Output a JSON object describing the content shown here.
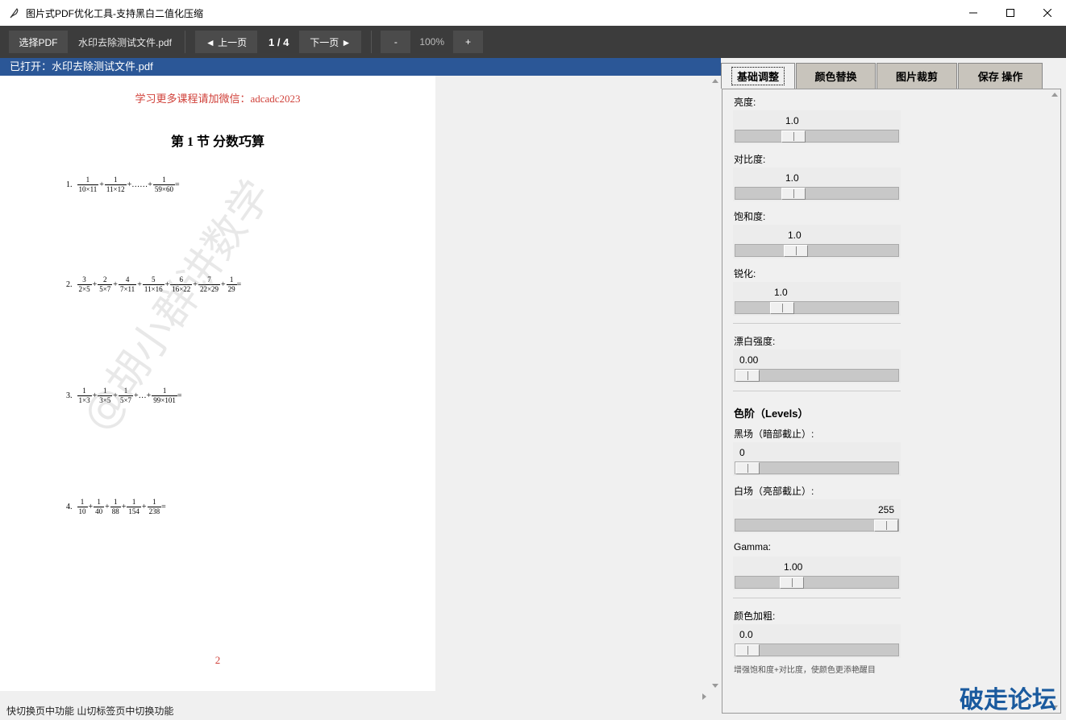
{
  "window": {
    "title": "图片式PDF优化工具-支持黑白二值化压缩",
    "icon": "feather-icon"
  },
  "toolbar": {
    "select_pdf": "选择PDF",
    "filename": "水印去除测试文件.pdf",
    "prev": "◄ 上一页",
    "page_indicator": "1 / 4",
    "next": "下一页 ►",
    "zoom_out": "-",
    "zoom": "100%",
    "zoom_in": "+"
  },
  "viewer": {
    "opened": "已打开：水印去除测试文件.pdf",
    "status": "快切换页中功能 山切标签页中切换功能"
  },
  "pdf": {
    "header": "学习更多课程请加微信：adcadc2023",
    "heading": "第 1 节  分数巧算",
    "watermark": "@胡小群讲数学",
    "page_number": "2",
    "problems": [
      {
        "num": "1.",
        "fracs": [
          [
            "1",
            "10×11"
          ],
          [
            "1",
            "11×12"
          ],
          [
            "1",
            "59×60"
          ]
        ],
        "ellipsis": "+……+",
        "end": "="
      },
      {
        "num": "2.",
        "fracs": [
          [
            "3",
            "2×5"
          ],
          [
            "2",
            "5×7"
          ],
          [
            "4",
            "7×11"
          ],
          [
            "5",
            "11×16"
          ],
          [
            "6",
            "16×22"
          ],
          [
            "7",
            "22×29"
          ],
          [
            "1",
            "29"
          ]
        ],
        "end": "="
      },
      {
        "num": "3.",
        "fracs": [
          [
            "1",
            "1×3"
          ],
          [
            "1",
            "3×5"
          ],
          [
            "1",
            "5×7"
          ],
          [
            "1",
            "99×101"
          ]
        ],
        "ellipsis": "+…+",
        "end": "="
      },
      {
        "num": "4.",
        "fracs": [
          [
            "1",
            "10"
          ],
          [
            "1",
            "40"
          ],
          [
            "1",
            "88"
          ],
          [
            "1",
            "154"
          ],
          [
            "1",
            "238"
          ]
        ],
        "end": "="
      }
    ]
  },
  "tabs": [
    {
      "label": "基础调整",
      "active": true
    },
    {
      "label": "颜色替换",
      "active": false
    },
    {
      "label": "图片裁剪",
      "active": false
    },
    {
      "label": "保存 操作",
      "active": false
    }
  ],
  "controls": {
    "brightness": {
      "label": "亮度:",
      "value": "1.0",
      "fraction": 0.33
    },
    "contrast": {
      "label": "对比度:",
      "value": "1.0",
      "fraction": 0.33
    },
    "saturation": {
      "label": "饱和度:",
      "value": "1.0",
      "fraction": 0.35
    },
    "sharpen": {
      "label": "锐化:",
      "value": "1.0",
      "fraction": 0.25
    },
    "bleach": {
      "label": "漂白强度:",
      "value": "0.00",
      "fraction": 0.0
    },
    "levels_title": "色阶（Levels）",
    "black": {
      "label": "黑场（暗部截止）:",
      "value": "0",
      "fraction": 0.0
    },
    "white": {
      "label": "白场（亮部截止）:",
      "value": "255",
      "fraction": 1.0
    },
    "gamma": {
      "label": "Gamma:",
      "value": "1.00",
      "fraction": 0.32
    },
    "bold": {
      "label": "颜色加粗:",
      "value": "0.0",
      "fraction": 0.0
    },
    "hint": "增强饱和度+对比度，使颜色更添艳醒目"
  },
  "logo": "破走论坛",
  "colors": {
    "accent": "#2b5797",
    "toolbar": "#3c3c3c",
    "header_red": "#d0413a",
    "logo_blue": "#1a5a9e"
  }
}
